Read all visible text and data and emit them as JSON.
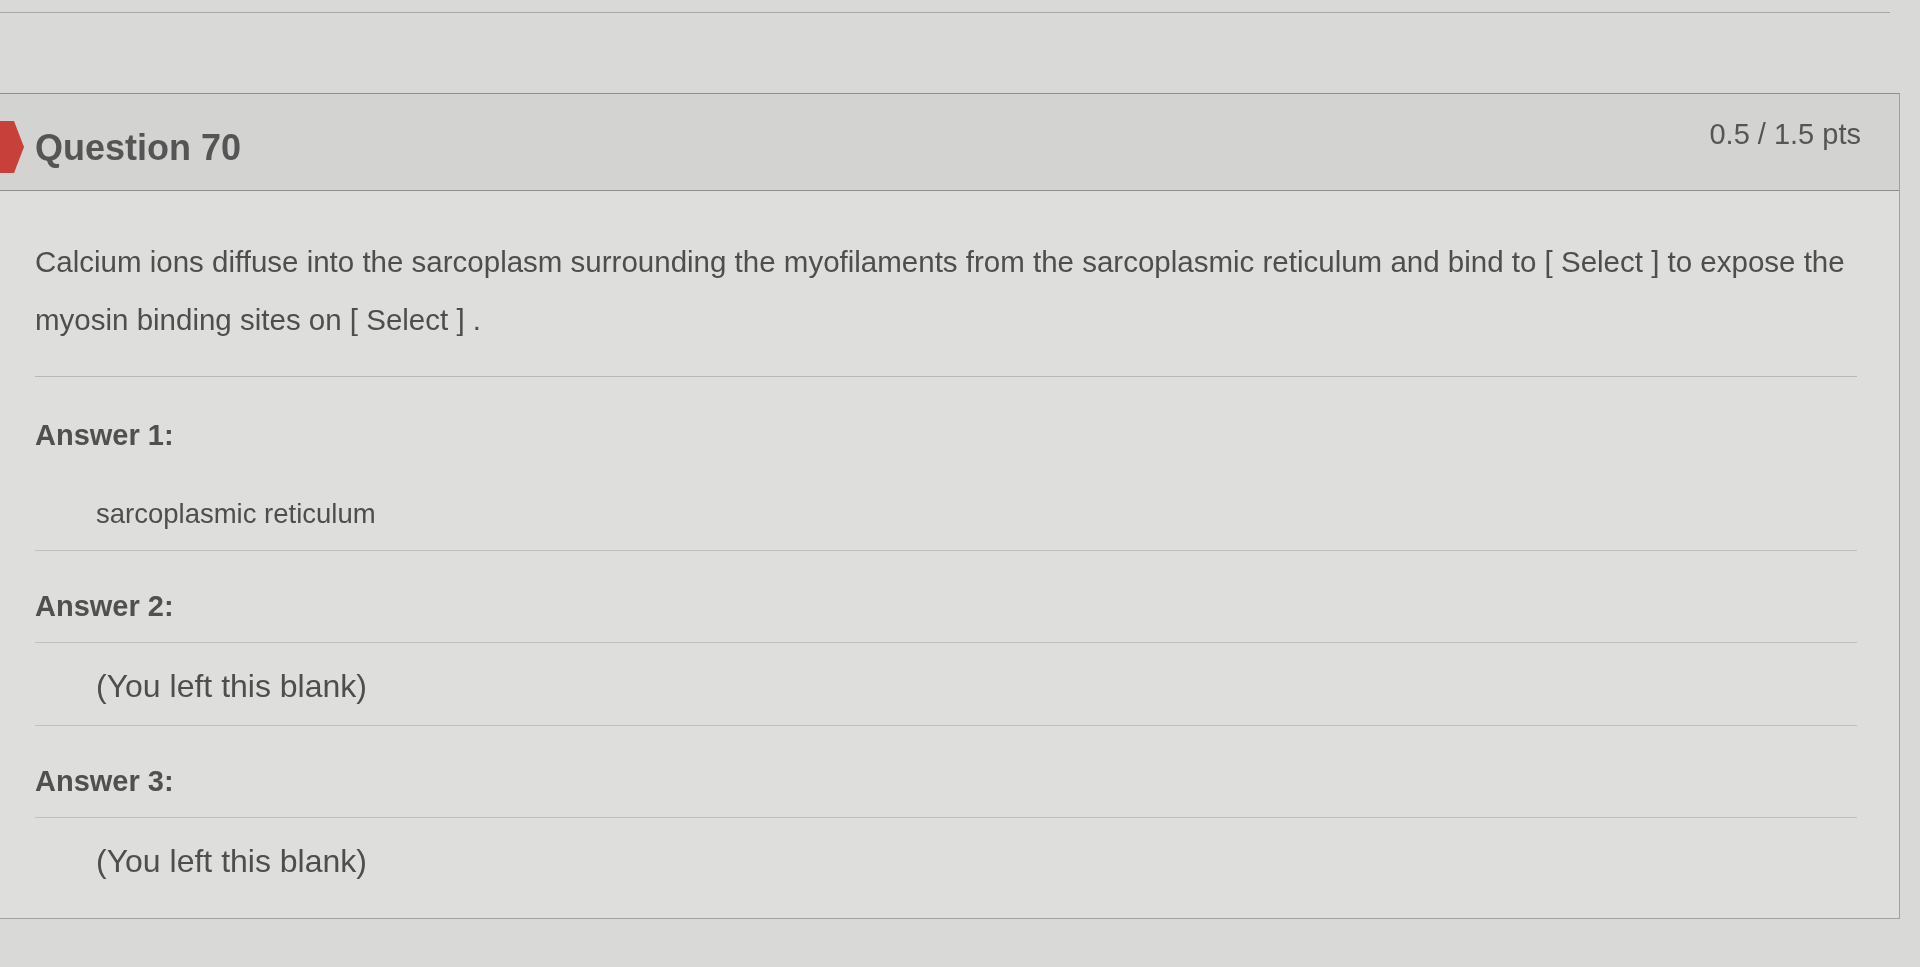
{
  "question": {
    "incorrect": true,
    "title": "Question 70",
    "points": "0.5 / 1.5 pts",
    "text": "Calcium ions diffuse into the sarcoplasm surrounding the myofilaments from the sarcoplasmic reticulum and bind to [ Select ] to expose the myosin binding sites on [ Select ] ."
  },
  "answers": [
    {
      "label": "Answer 1:",
      "kind": "response",
      "response": "sarcoplasmic reticulum"
    },
    {
      "label": "Answer 2:",
      "kind": "blank",
      "response": "(You left this blank)"
    },
    {
      "label": "Answer 3:",
      "kind": "blank",
      "response": "(You left this blank)"
    }
  ]
}
